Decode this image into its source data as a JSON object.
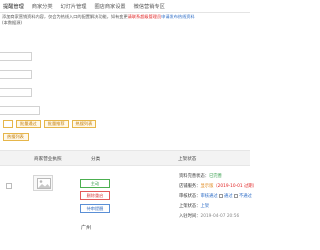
{
  "nav": {
    "items": [
      "提醒管理",
      "商家分类",
      "幻灯片管理",
      "圈店商家设置",
      "微信营销专区"
    ]
  },
  "notice": {
    "line1_prefix": "添加商家营销资料内容，仅会为热线入口的配置解决功能，如有变更",
    "line1_alert": "请联系超级管理员",
    "line1_link": "申请发布热线资料",
    "line2": "(本数据源)"
  },
  "actions": {
    "approve_label": "批量通过",
    "batch_label": "批量推荐",
    "hot_label": "热搜列表"
  },
  "table": {
    "headers": {
      "name": "商家营业执照",
      "category": "分类",
      "status": "上架状态"
    }
  },
  "row": {
    "status_buttons": [
      "主动",
      "删除重启",
      "待审提醒"
    ],
    "city": "广州",
    "info": {
      "audit_label": "资料完善状态：",
      "audit_value": "已完善",
      "level_label": "店铺服务：",
      "level_value": "显示版",
      "level_date": "（2019-10-01 过期）",
      "review_label": "审核状态：",
      "review_value": "审核通过",
      "review_options": [
        "通过",
        "不通过"
      ],
      "shelf_label": "上架状态：",
      "shelf_value": "上架",
      "entry_label": "入驻时间：",
      "entry_value": "2019-04-07 20:56"
    }
  },
  "colors": {
    "accent_orange": "#e6b64a",
    "success_green": "#2e9b45",
    "danger_red": "#e02020",
    "link_blue": "#2f6ec7"
  }
}
